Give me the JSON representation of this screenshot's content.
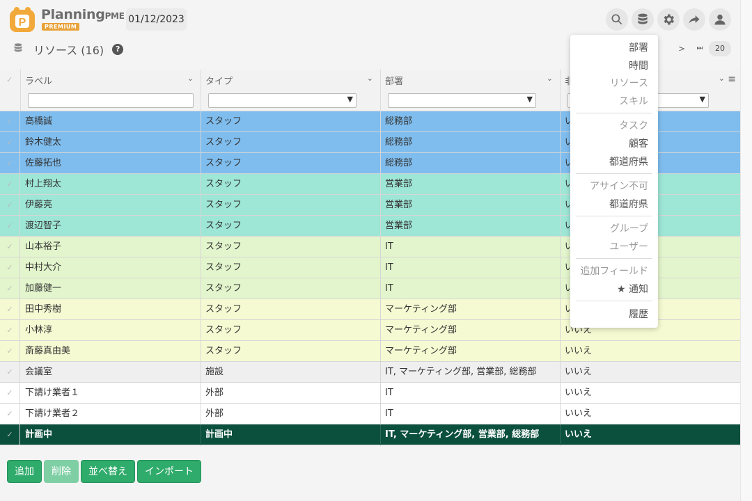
{
  "app": {
    "brand": "Planning",
    "brand_suffix": "PME",
    "badge": "PREMIUM",
    "date": "01/12/2023"
  },
  "page": {
    "title": "リソース (16)",
    "help": "?"
  },
  "pager": {
    "next": ">",
    "last": "⏭",
    "page_size": "20"
  },
  "grid": {
    "columns": [
      "ラベル",
      "タイプ",
      "部署",
      "非"
    ],
    "rows": [
      {
        "label": "高橋誠",
        "type": "スタッフ",
        "dept": "総務部",
        "flag": "い",
        "color": "#7fbdee"
      },
      {
        "label": "鈴木健太",
        "type": "スタッフ",
        "dept": "総務部",
        "flag": "い",
        "color": "#7fbdee"
      },
      {
        "label": "佐藤拓也",
        "type": "スタッフ",
        "dept": "総務部",
        "flag": "い",
        "color": "#7fbdee"
      },
      {
        "label": "村上翔太",
        "type": "スタッフ",
        "dept": "営業部",
        "flag": "い",
        "color": "#9ee6d6"
      },
      {
        "label": "伊藤亮",
        "type": "スタッフ",
        "dept": "営業部",
        "flag": "い",
        "color": "#9ee6d6"
      },
      {
        "label": "渡辺智子",
        "type": "スタッフ",
        "dept": "営業部",
        "flag": "い",
        "color": "#9ee6d6"
      },
      {
        "label": "山本裕子",
        "type": "スタッフ",
        "dept": "IT",
        "flag": "い",
        "color": "#e3f5cc"
      },
      {
        "label": "中村大介",
        "type": "スタッフ",
        "dept": "IT",
        "flag": "い",
        "color": "#e3f5cc"
      },
      {
        "label": "加藤健一",
        "type": "スタッフ",
        "dept": "IT",
        "flag": "い",
        "color": "#e3f5cc"
      },
      {
        "label": "田中秀樹",
        "type": "スタッフ",
        "dept": "マーケティング部",
        "flag": "い",
        "color": "#f6fad2"
      },
      {
        "label": "小林淳",
        "type": "スタッフ",
        "dept": "マーケティング部",
        "flag": "いいえ",
        "color": "#f6fad2"
      },
      {
        "label": "斎藤真由美",
        "type": "スタッフ",
        "dept": "マーケティング部",
        "flag": "いいえ",
        "color": "#f6fad2"
      },
      {
        "label": "会議室",
        "type": "施設",
        "dept": "IT, マーケティング部, 営業部, 総務部",
        "flag": "いいえ",
        "color": "#efefef"
      },
      {
        "label": "下請け業者１",
        "type": "外部",
        "dept": "IT",
        "flag": "いいえ",
        "color": "#ffffff"
      },
      {
        "label": "下請け業者２",
        "type": "外部",
        "dept": "IT",
        "flag": "いいえ",
        "color": "#ffffff"
      },
      {
        "label": "計画中",
        "type": "計画中",
        "dept": "IT, マーケティング部, 営業部, 総務部",
        "flag": "いいえ",
        "color": "#0b4f3d"
      }
    ]
  },
  "footer": {
    "add": "追加",
    "delete": "削除",
    "sort": "並べ替え",
    "import": "インポート"
  },
  "dropdown": {
    "items": [
      {
        "label": "部署",
        "active": true
      },
      {
        "label": "時間",
        "active": true
      },
      {
        "label": "リソース",
        "active": false
      },
      {
        "label": "スキル",
        "active": false
      },
      {
        "label": "タスク",
        "active": false
      },
      {
        "label": "顧客",
        "active": true
      },
      {
        "label": "都道府県",
        "active": true
      },
      {
        "label": "アサイン不可",
        "active": false
      },
      {
        "label": "都道府県",
        "active": true
      },
      {
        "label": "グループ",
        "active": false
      },
      {
        "label": "ユーザー",
        "active": false
      },
      {
        "label": "追加フィールド",
        "active": false
      },
      {
        "label": "通知",
        "active": true,
        "icon": "star-icon"
      },
      {
        "label": "履歴",
        "active": true
      }
    ]
  },
  "colors": {
    "accent_green": "#2fab6b",
    "planning_row": "#0b4f3d",
    "logo_orange": "#f2a93b"
  }
}
